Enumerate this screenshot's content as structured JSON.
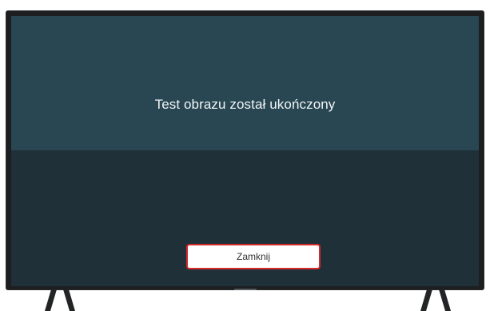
{
  "dialog": {
    "message": "Test obrazu został ukończony",
    "close_label": "Zamknij"
  },
  "colors": {
    "panel": "#284753",
    "screen": "#1f3038",
    "frame": "#1c1e1f",
    "focus_border": "#d42a2a"
  },
  "icons": {
    "stand": "tv-stand-icon"
  }
}
